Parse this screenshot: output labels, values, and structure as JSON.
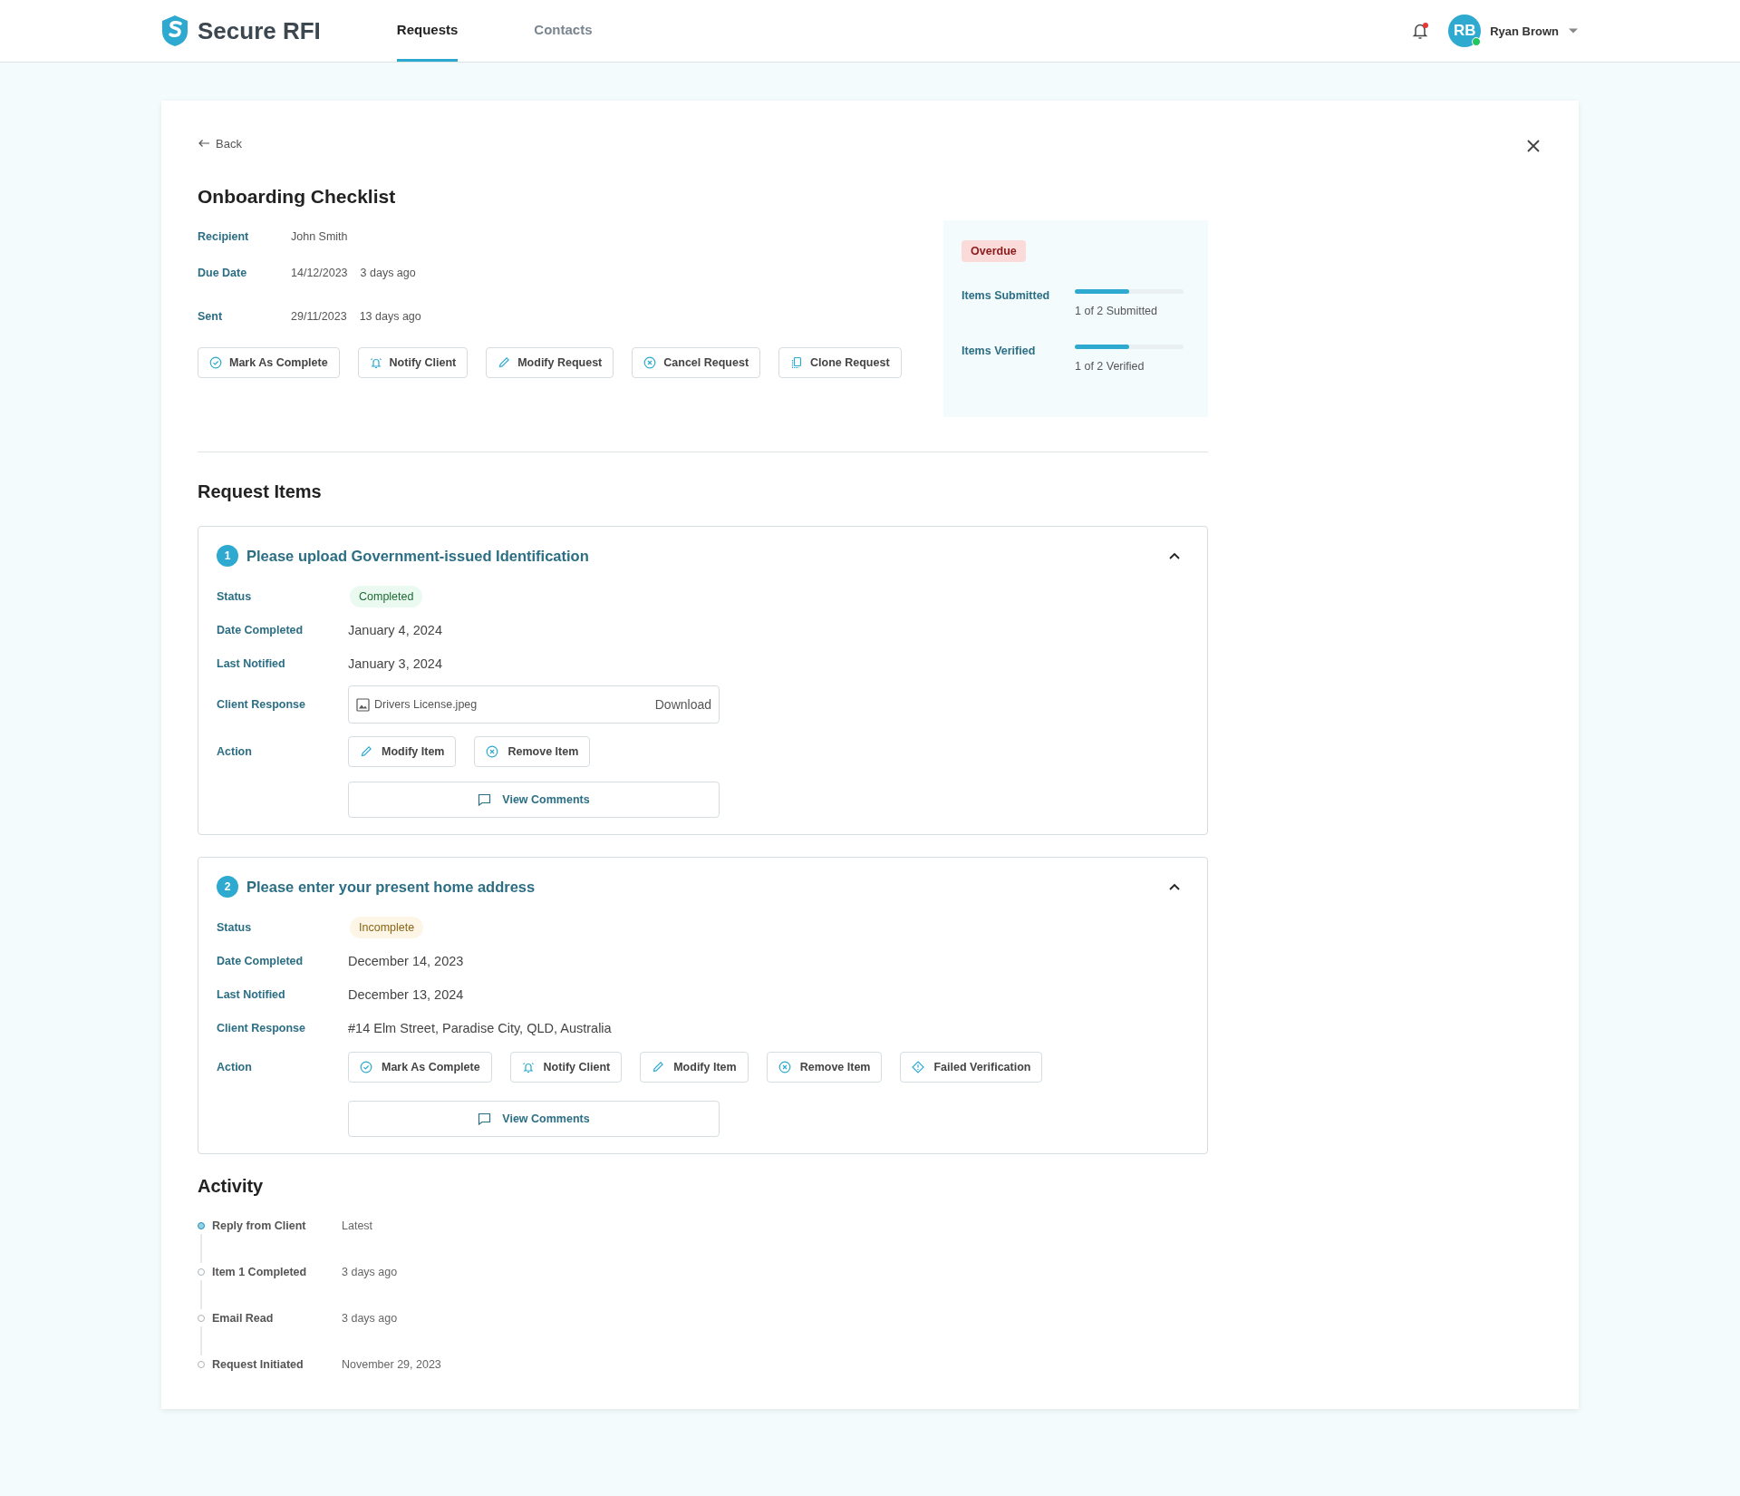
{
  "header": {
    "logo": "Secure RFI",
    "tabs": [
      {
        "label": "Requests",
        "selected": true
      },
      {
        "label": "Contacts",
        "selected": false
      }
    ],
    "notifications": {
      "unread": true
    },
    "user": {
      "initials": "RB",
      "name": "Ryan Brown",
      "online": true
    }
  },
  "request": {
    "back": "Back",
    "title": "Onboarding Checklist",
    "fields": [
      {
        "label": "Recipient",
        "values": [
          "John Smith"
        ]
      },
      {
        "label": "Due Date",
        "values": [
          "14/12/2023",
          "3 days ago"
        ]
      },
      {
        "label": "Sent",
        "values": [
          "29/11/2023",
          "13 days ago"
        ]
      }
    ],
    "actions": [
      {
        "kind": "check",
        "label": "Mark As Complete"
      },
      {
        "kind": "bell",
        "label": "Notify Client"
      },
      {
        "kind": "pencil",
        "label": "Modify Request"
      },
      {
        "kind": "cancel",
        "label": "Cancel Request"
      },
      {
        "kind": "copy",
        "label": "Clone Request"
      }
    ],
    "summary": {
      "badge": "Overdue",
      "metrics": [
        {
          "label": "Items Submitted",
          "level": 0.5,
          "reading": "1 of 2 Submitted"
        },
        {
          "label": "Items Verified",
          "level": 0.5,
          "reading": "1 of 2 Verified"
        }
      ]
    }
  },
  "request_items": {
    "title": "Request Items",
    "items": [
      {
        "number": "1",
        "title": "Please upload Government-issued Identification",
        "expanded": true,
        "status_label": "Status",
        "status": {
          "kind": "completed",
          "text": "Completed"
        },
        "rows": [
          {
            "label": "Date Completed",
            "value": "January 4, 2024"
          },
          {
            "label": "Last Notified",
            "value": "January 3, 2024"
          }
        ],
        "response_label": "Client Response",
        "response": {
          "kind": "file",
          "file_name": "Drivers License.jpeg",
          "action": "Download"
        },
        "action_label": "Action",
        "actions": [
          {
            "kind": "pencil",
            "label": "Modify Item"
          },
          {
            "kind": "cancel",
            "label": "Remove Item"
          }
        ],
        "comments": "View Comments"
      },
      {
        "number": "2",
        "title": "Please enter your present home address",
        "expanded": true,
        "status_label": "Status",
        "status": {
          "kind": "incomplete",
          "text": "Incomplete"
        },
        "rows": [
          {
            "label": "Date Completed",
            "value": "December 14, 2023"
          },
          {
            "label": "Last Notified",
            "value": "December 13, 2024"
          }
        ],
        "response_label": "Client Response",
        "response": {
          "kind": "text",
          "text": "#14 Elm Street, Paradise City, QLD, Australia"
        },
        "action_label": "Action",
        "actions": [
          {
            "kind": "check",
            "label": "Mark As Complete"
          },
          {
            "kind": "bell",
            "label": "Notify Client"
          },
          {
            "kind": "pencil",
            "label": "Modify Item"
          },
          {
            "kind": "cancel",
            "label": "Remove Item"
          },
          {
            "kind": "warning",
            "label": "Failed Verification"
          }
        ],
        "comments": "View Comments"
      }
    ]
  },
  "activity": {
    "title": "Activity",
    "events": [
      {
        "label": "Reply from Client",
        "time": "Latest",
        "active": true
      },
      {
        "label": "Item 1 Completed",
        "time": "3 days ago",
        "active": false
      },
      {
        "label": "Email Read",
        "time": "3 days ago",
        "active": false
      },
      {
        "label": "Request Initiated",
        "time": "November 29, 2023",
        "active": false
      }
    ]
  }
}
